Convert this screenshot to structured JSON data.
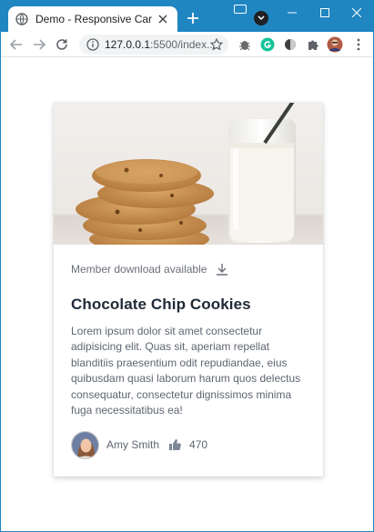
{
  "browser": {
    "tab_title": "Demo - Responsive Card Compo",
    "url_host": "127.0.0.1",
    "url_rest": ":5500/index..."
  },
  "card": {
    "member_text": "Member download available",
    "title": "Chocolate Chip Cookies",
    "description": "Lorem ipsum dolor sit amet consectetur adipisicing elit. Quas sit, aperiam repellat blanditiis praesentium odit repudiandae, eius quibusdam quasi laborum harum quos delectus consequatur, consectetur dignissimos minima fuga necessitatibus ea!",
    "author": "Amy Smith",
    "likes": "470"
  },
  "colors": {
    "titlebar": "#1f86c1",
    "accent_green": "#1ea362"
  }
}
